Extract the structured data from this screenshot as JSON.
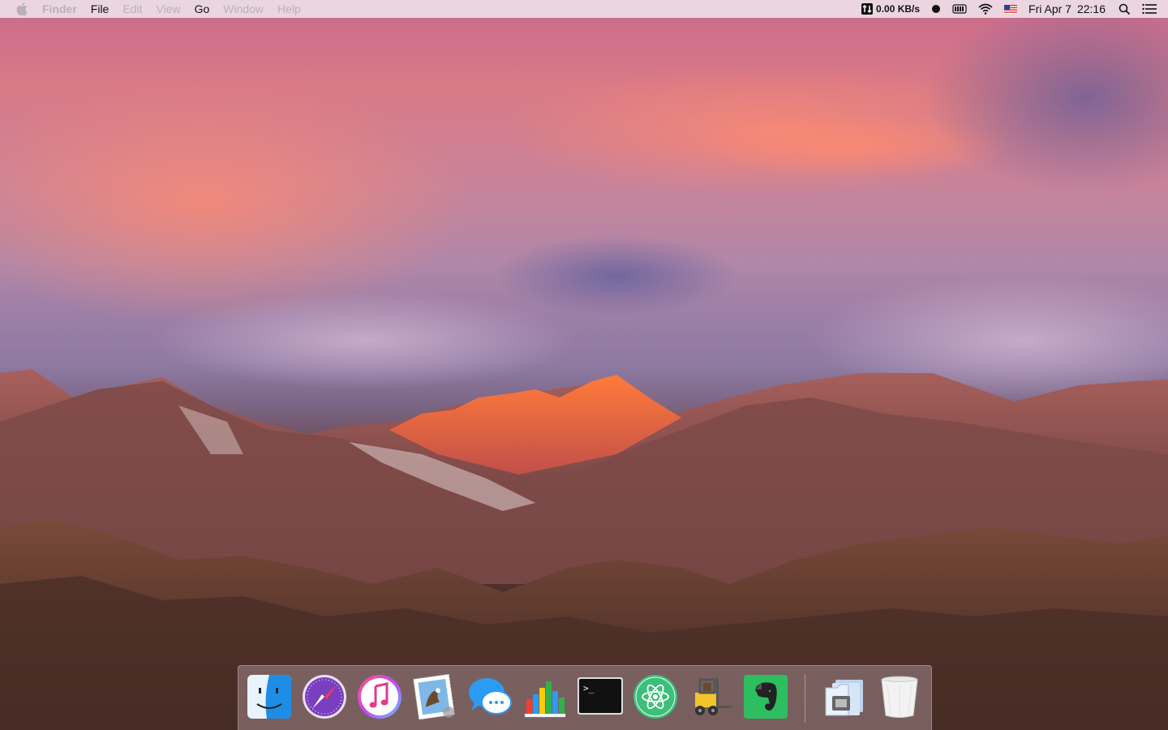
{
  "menubar": {
    "app_name": "Finder",
    "menus": [
      "File",
      "Edit",
      "View",
      "Go",
      "Window",
      "Help"
    ],
    "network_speed": "0.00 KB/s",
    "clock_day": "Fri Apr 7",
    "clock_time": "22:16"
  },
  "dock": {
    "apps": [
      {
        "name": "Finder",
        "icon": "finder-icon",
        "running": true
      },
      {
        "name": "Safari",
        "icon": "safari-icon",
        "running": false
      },
      {
        "name": "iTunes",
        "icon": "itunes-icon",
        "running": false
      },
      {
        "name": "Mail",
        "icon": "mail-icon",
        "running": false
      },
      {
        "name": "Messages",
        "icon": "messages-icon",
        "running": false
      },
      {
        "name": "Numbers",
        "icon": "numbers-icon",
        "running": false
      },
      {
        "name": "Terminal",
        "icon": "terminal-icon",
        "running": false
      },
      {
        "name": "Atom",
        "icon": "atom-icon",
        "running": false
      },
      {
        "name": "Transmit",
        "icon": "forklift-icon",
        "running": false
      },
      {
        "name": "Evernote",
        "icon": "evernote-icon",
        "running": false
      },
      {
        "name": "Downloads",
        "icon": "downloads-folder-icon",
        "running": false
      },
      {
        "name": "Trash",
        "icon": "trash-icon",
        "running": false
      }
    ],
    "terminal_prompt": ">_"
  },
  "colors": {
    "menubar_bg": "#f0e8ee",
    "dim_menu": "#b8b0b8",
    "safari_purple": "#7a3fc0",
    "numbers_green": "#2fb34a",
    "atom_green": "#3dbf7a",
    "evernote_green": "#2dbe60",
    "messages_blue": "#2c9bf3",
    "finder_blue": "#1e8de6"
  }
}
